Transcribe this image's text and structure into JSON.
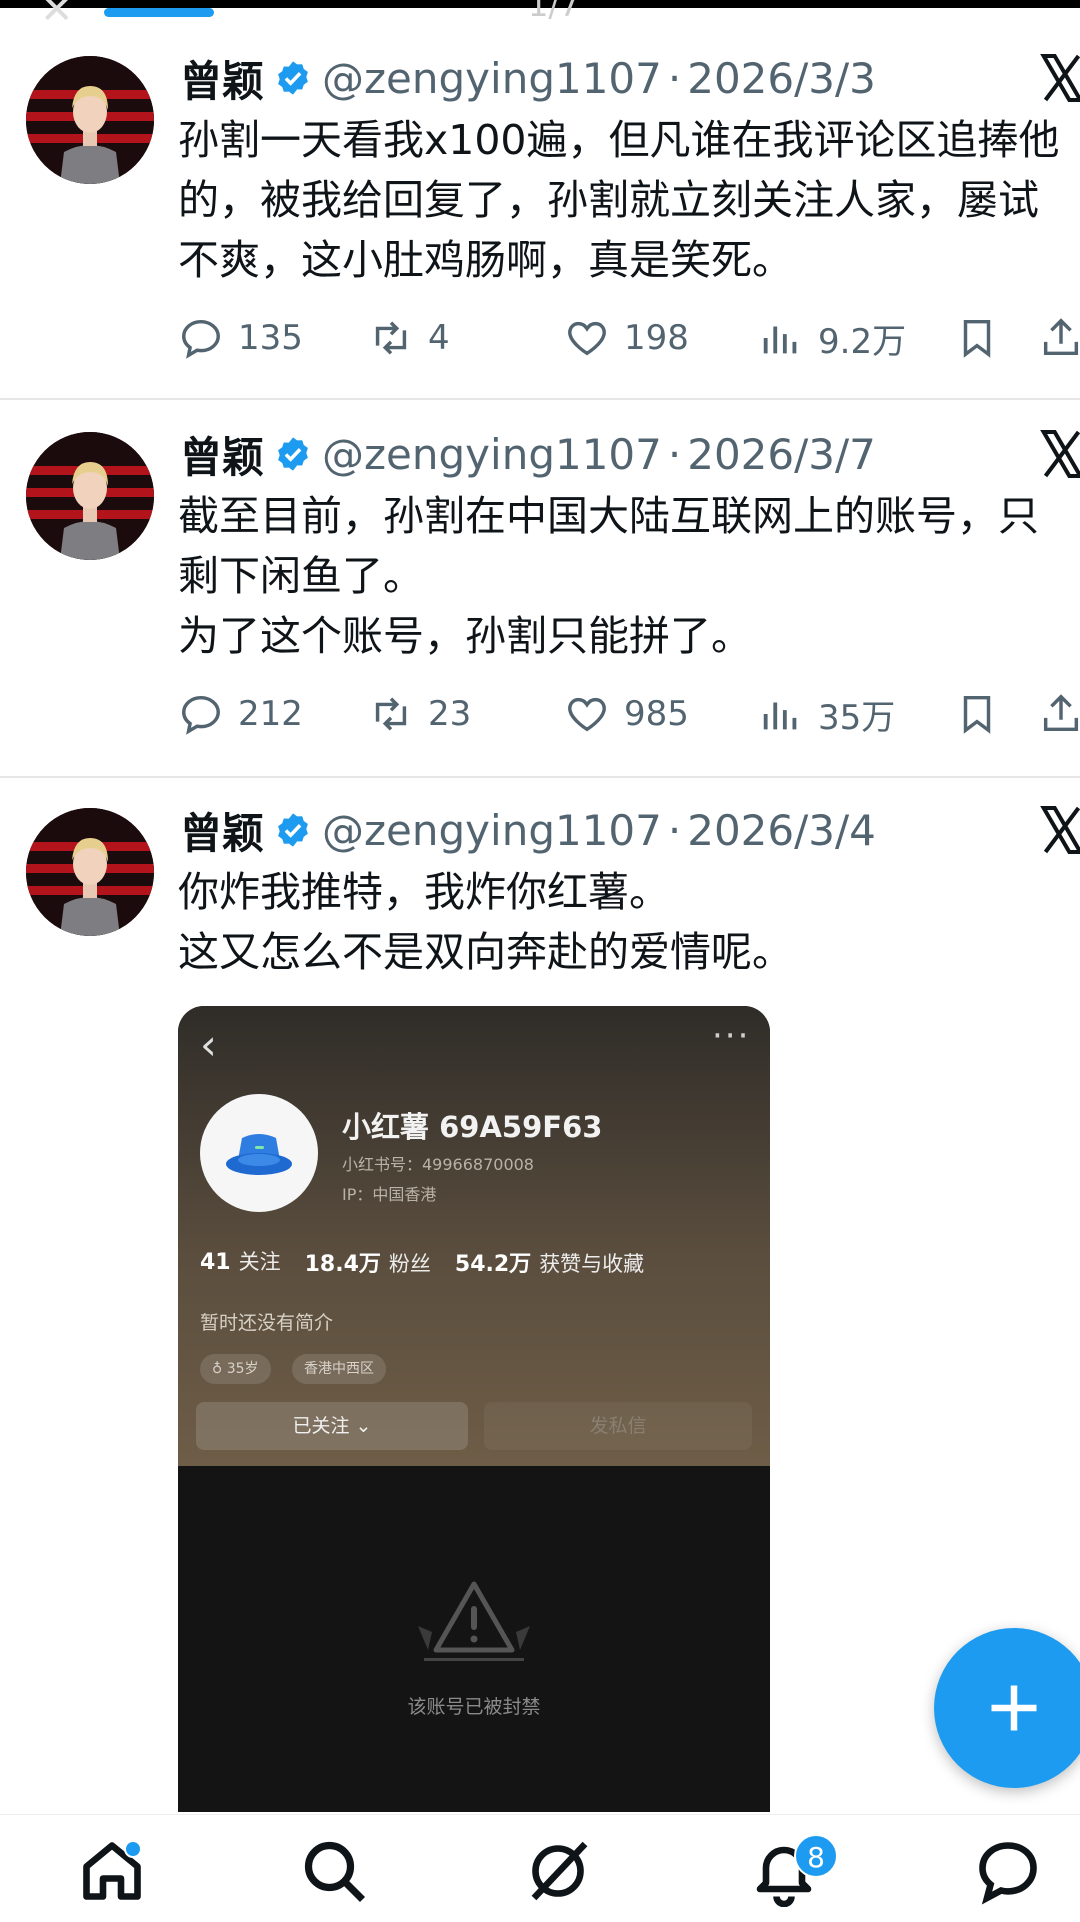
{
  "viewer": {
    "counter_text": "1/7"
  },
  "tweets": [
    {
      "name": "曾颖",
      "handle": "@zengying1107",
      "separator": "·",
      "date": "2026/3/3",
      "lines": [
        "孙割一天看我x100遍，但凡谁在我评论区追捧他",
        "的，被我给回复了，孙割就立刻关注人家，屡试",
        "不爽，这小肚鸡肠啊，真是笑死。"
      ],
      "replies": "135",
      "reposts": "4",
      "likes": "198",
      "views": "9.2万"
    },
    {
      "name": "曾颖",
      "handle": "@zengying1107",
      "separator": "·",
      "date": "2026/3/7",
      "lines": [
        "截至目前，孙割在中国大陆互联网上的账号，只",
        "剩下闲鱼了。",
        "为了这个账号，孙割只能拼了。"
      ],
      "replies": "212",
      "reposts": "23",
      "likes": "985",
      "views": "35万"
    },
    {
      "name": "曾颖",
      "handle": "@zengying1107",
      "separator": "·",
      "date": "2026/3/4",
      "lines": [
        "你炸我推特，我炸你红薯。",
        "这又怎么不是双向奔赴的爱情呢。"
      ]
    }
  ],
  "embedded": {
    "profile_name": "小红薯 69A59F63",
    "profile_id": "小红书号：49966870008",
    "profile_ip": "IP：中国香港",
    "following_count": "41",
    "following_label": "关注",
    "followers_count": "18.4万",
    "followers_label": "粉丝",
    "likes_count": "54.2万",
    "likes_label": "获赞与收藏",
    "bio": "暂时还没有简介",
    "tag_age": "35岁",
    "tag_location": "香港中西区",
    "follow_button": "已关注",
    "message_button": "发私信",
    "banned_text": "该账号已被封禁"
  },
  "nav": {
    "notification_badge": "8"
  },
  "colors": {
    "accent": "#1d9bf0",
    "text": "#0f1419",
    "muted": "#536471"
  }
}
